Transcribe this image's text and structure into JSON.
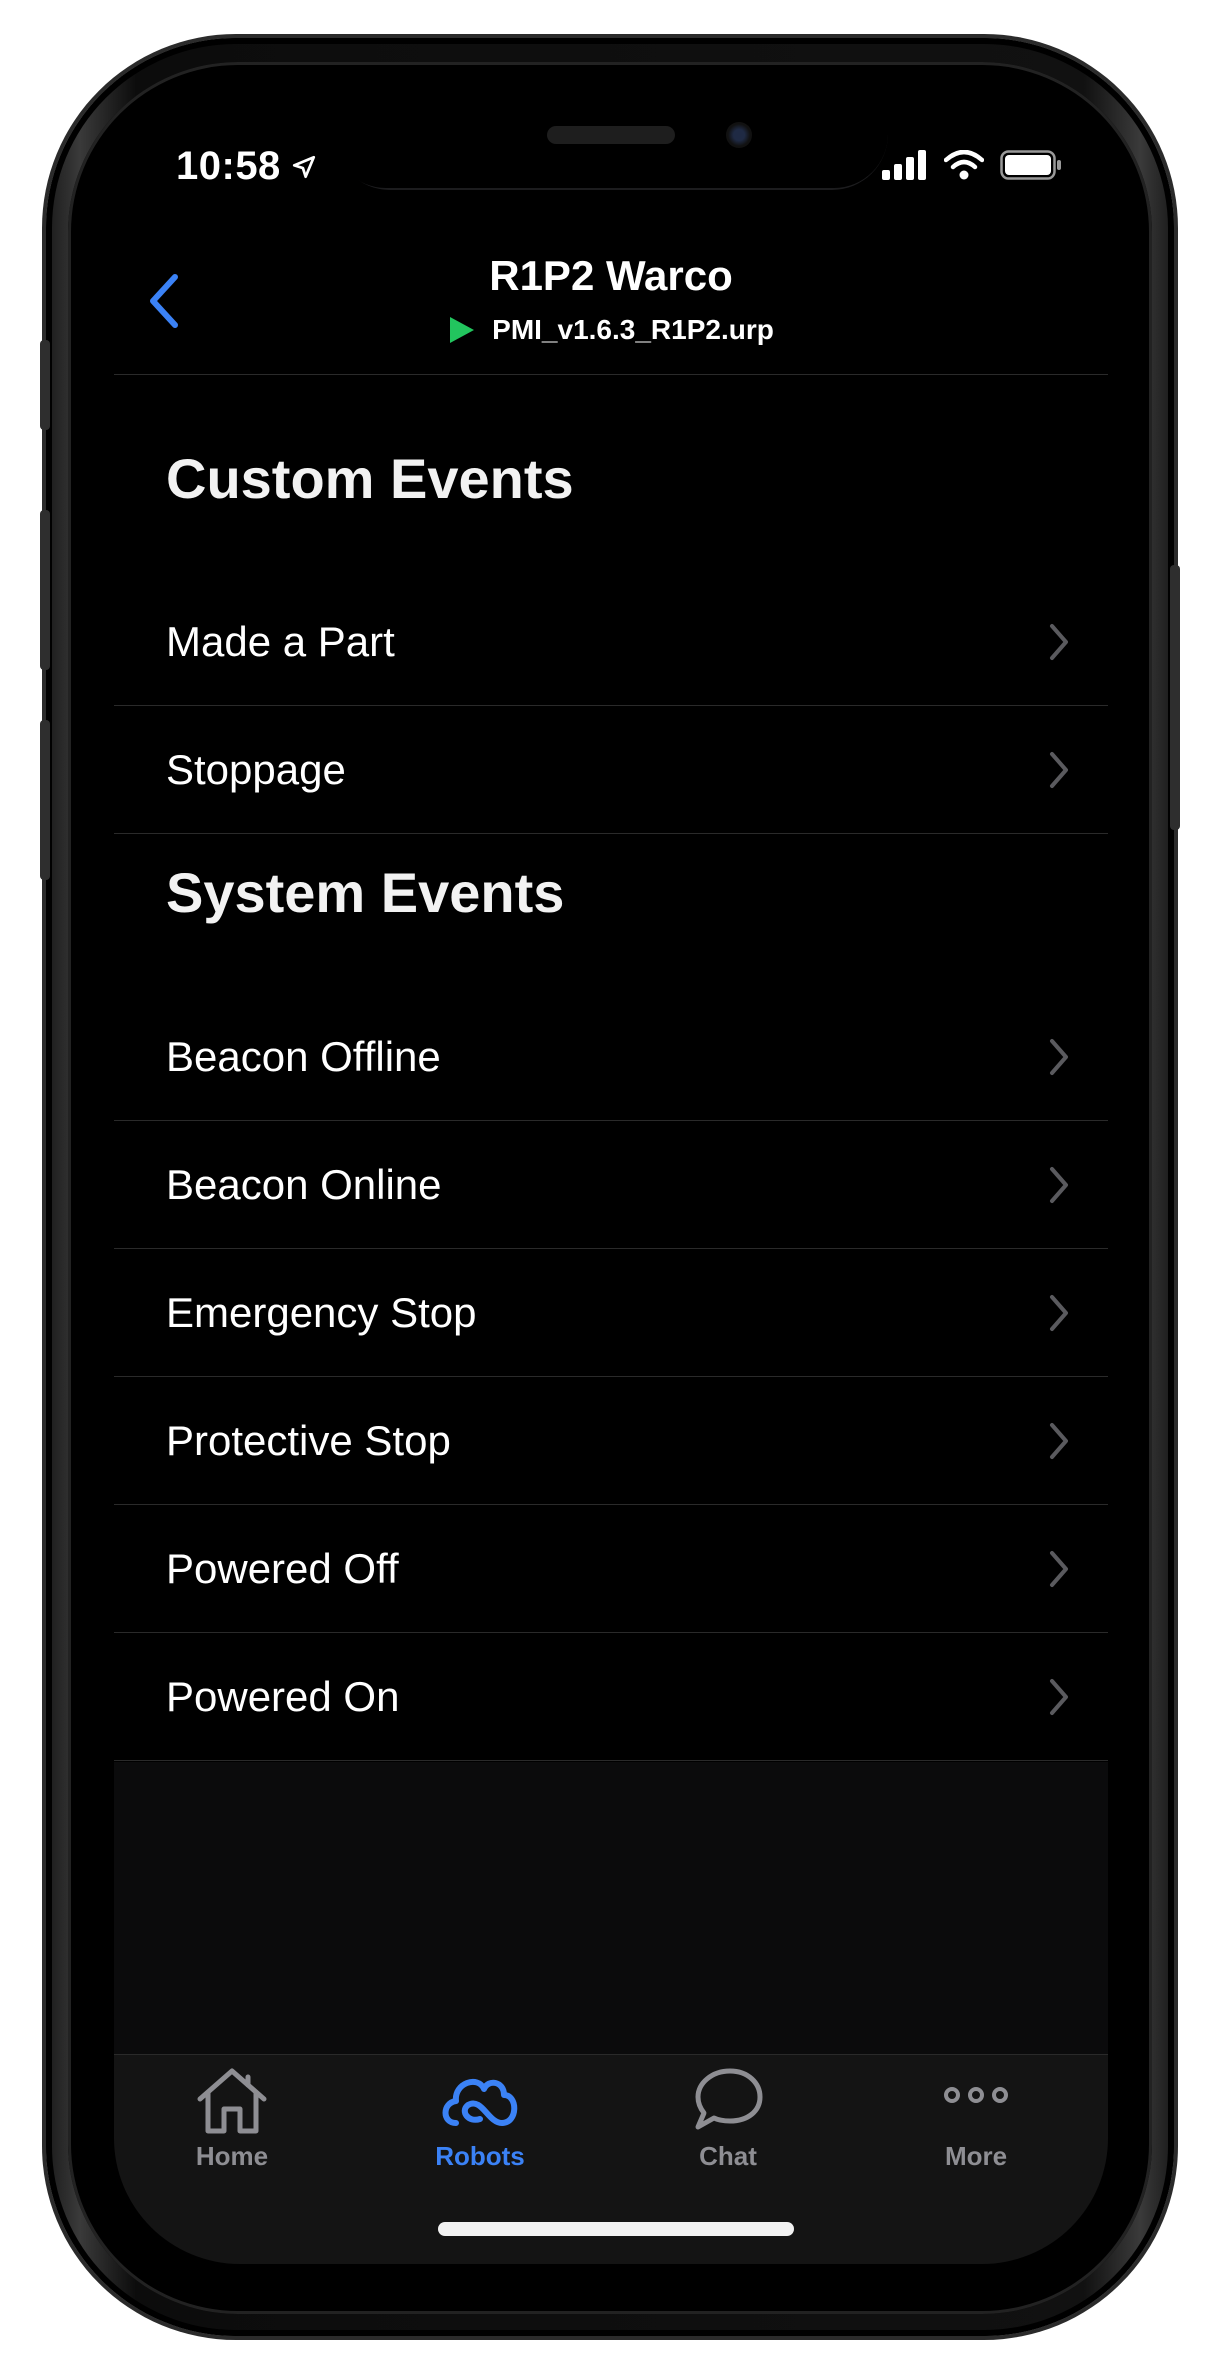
{
  "status_bar": {
    "time": "10:58"
  },
  "nav": {
    "title": "R1P2 Warco",
    "program": "PMI_v1.6.3_R1P2.urp"
  },
  "custom_events": {
    "title": "Custom Events",
    "items": [
      {
        "label": "Made a Part"
      },
      {
        "label": "Stoppage"
      }
    ]
  },
  "system_events": {
    "title": "System Events",
    "items": [
      {
        "label": "Beacon Offline"
      },
      {
        "label": "Beacon Online"
      },
      {
        "label": "Emergency Stop"
      },
      {
        "label": "Protective Stop"
      },
      {
        "label": "Powered Off"
      },
      {
        "label": "Powered On"
      }
    ]
  },
  "tabbar": {
    "tabs": [
      {
        "label": "Home",
        "icon": "house-icon",
        "active": false
      },
      {
        "label": "Robots",
        "icon": "robots-icon",
        "active": true
      },
      {
        "label": "Chat",
        "icon": "chat-bubble-icon",
        "active": false
      },
      {
        "label": "More",
        "icon": "ellipsis-icon",
        "active": false
      }
    ]
  },
  "colors": {
    "accent": "#3b82f6",
    "play": "#22c55e",
    "inactive": "#8e8e93"
  }
}
